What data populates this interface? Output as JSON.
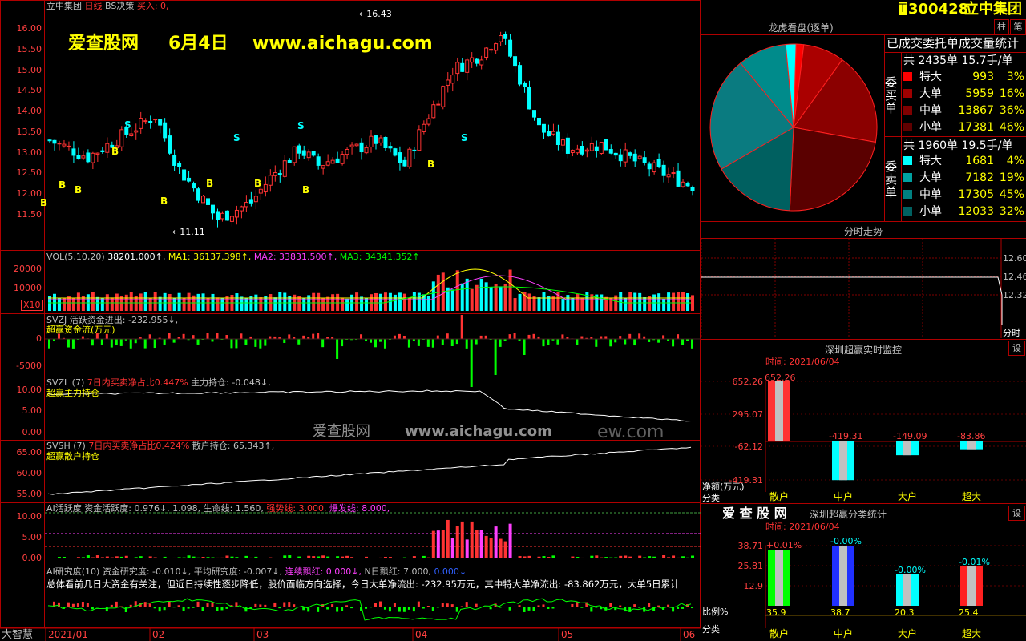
{
  "stock": {
    "code": "300428",
    "name": "立中集团",
    "badge": "T"
  },
  "main_chart": {
    "header": [
      {
        "t": "立中集团",
        "c": "gry"
      },
      {
        "t": "日线",
        "c": "red"
      },
      {
        "t": "BS决策",
        "c": "gry"
      },
      {
        "t": "买入: 0,",
        "c": "red"
      }
    ],
    "watermark": {
      "site": "爱查股网",
      "date": "6月4日",
      "url": "www.aichagu.com"
    },
    "yticks": [
      "16.00",
      "15.50",
      "15.00",
      "14.50",
      "14.00",
      "13.50",
      "13.00",
      "12.50",
      "12.00",
      "11.50"
    ],
    "high_label": "16.43",
    "low_label": "11.11",
    "signals": {
      "b": "B",
      "s": "S"
    }
  },
  "vol": {
    "header": [
      {
        "t": "VOL(5,10,20)",
        "c": "gry"
      },
      {
        "t": "38201.000↑,",
        "c": "wht"
      },
      {
        "t": "MA1: 36137.398↑,",
        "c": "yel"
      },
      {
        "t": "MA2: 33831.500↑,",
        "c": "mag"
      },
      {
        "t": "MA3: 34341.352↑",
        "c": "grn"
      }
    ],
    "yticks": [
      "20000",
      "10000"
    ],
    "unit": "X10"
  },
  "svzj": {
    "header": [
      {
        "t": "SVZJ",
        "c": "gry"
      },
      {
        "t": "活跃资金进出: -232.955↓,",
        "c": "gry"
      }
    ],
    "sub": "超赢资金流(万元)",
    "yticks": [
      "0",
      "-5000"
    ]
  },
  "svzl": {
    "header": [
      {
        "t": "SVZL (7)",
        "c": "gry"
      },
      {
        "t": "7日内买卖净占比0.447%",
        "c": "red"
      },
      {
        "t": "主力持仓: -0.048↓,",
        "c": "gry"
      }
    ],
    "sub": "超赢主力持仓",
    "yticks": [
      "10.00",
      "5.00",
      "0.00"
    ]
  },
  "svsh": {
    "header": [
      {
        "t": "SVSH (7)",
        "c": "gry"
      },
      {
        "t": "7日内买卖净占比0.424%",
        "c": "red"
      },
      {
        "t": "散户持仓: 65.343↑,",
        "c": "gry"
      }
    ],
    "sub": "超赢散户持仓",
    "yticks": [
      "65.00",
      "60.00",
      "55.00"
    ]
  },
  "ai_active": {
    "header": [
      {
        "t": "AI活跃度",
        "c": "gry"
      },
      {
        "t": "资金活跃度: 0.976↓,",
        "c": "gry"
      },
      {
        "t": "1.098,",
        "c": "gry"
      },
      {
        "t": "生命线: 1.560,",
        "c": "gry"
      },
      {
        "t": "强势线: 3.000,",
        "c": "red"
      },
      {
        "t": "爆发线: 8.000,",
        "c": "mag"
      }
    ],
    "yticks": [
      "10.00",
      "5.00",
      "0.00"
    ]
  },
  "ai_research": {
    "header": [
      {
        "t": "AI研究度(10)",
        "c": "gry"
      },
      {
        "t": "资金研究度: -0.010↓,",
        "c": "gry"
      },
      {
        "t": "平均研究度: -0.007↓,",
        "c": "gry"
      },
      {
        "t": "连续飘红: 0.000↓,",
        "c": "mag"
      },
      {
        "t": "N日飘红: 7.000,",
        "c": "gry"
      },
      {
        "t": "0.000↓",
        "c": "blu"
      }
    ],
    "summary": "总体看前几日大资金有关注，但近日持续性逐步降低，股价面临方向选择，今日大单净流出: -232.95万元，其中特大单净流出: -83.862万元，大单5日累计"
  },
  "time_axis": [
    "2021/01",
    "02",
    "03",
    "04",
    "05",
    "06"
  ],
  "logo": "大智慧",
  "watermark2": {
    "cn": "爱查股网",
    "url": "www.aichagu.com",
    "tail": "ew.com"
  },
  "right": {
    "buttons": [
      "柱",
      "笔"
    ],
    "dragon": {
      "title": "龙虎看盘(逐单)",
      "subtitle": "已成交委托单成交量统计",
      "buy": {
        "side_label": "委买单",
        "total": "共 2435单 15.7手/单",
        "rows": [
          {
            "label": "特大",
            "count": "993",
            "pct": "3%",
            "color": "#ff0000"
          },
          {
            "label": "大单",
            "count": "5959",
            "pct": "16%",
            "color": "#a00000"
          },
          {
            "label": "中单",
            "count": "13867",
            "pct": "36%",
            "color": "#800000"
          },
          {
            "label": "小单",
            "count": "17381",
            "pct": "46%",
            "color": "#600000"
          }
        ]
      },
      "sell": {
        "side_label": "委卖单",
        "total": "共 1960单 19.5手/单",
        "rows": [
          {
            "label": "特大",
            "count": "1681",
            "pct": "4%",
            "color": "#00ffff"
          },
          {
            "label": "大单",
            "count": "7182",
            "pct": "19%",
            "color": "#00a0a0"
          },
          {
            "label": "中单",
            "count": "17305",
            "pct": "45%",
            "color": "#008080"
          },
          {
            "label": "小单",
            "count": "12033",
            "pct": "32%",
            "color": "#006060"
          }
        ]
      },
      "pie": [
        {
          "v": 3,
          "color": "#ff0000"
        },
        {
          "v": 16,
          "color": "#aa0000"
        },
        {
          "v": 36,
          "color": "#8b0000"
        },
        {
          "v": 46,
          "color": "#5a0000"
        },
        {
          "v": 32,
          "color": "#006060"
        },
        {
          "v": 45,
          "color": "#0a7b80"
        },
        {
          "v": 19,
          "color": "#008b8b"
        },
        {
          "v": 4,
          "color": "#00ffff"
        }
      ]
    },
    "intraday": {
      "title": "分时走势",
      "yticks": [
        "12.60",
        "12.46",
        "12.32"
      ],
      "corner": "分时"
    },
    "monitor": {
      "title": "深圳超赢实时监控",
      "btn": "设",
      "time": "时间: 2021/06/04",
      "yticks": [
        "652.26",
        "295.07",
        "-62.12",
        "-419.31"
      ],
      "axis_label": "净额(万元)",
      "cat_label": "分类",
      "bars": [
        {
          "cat": "散户",
          "value": 652.26,
          "label": "652.26"
        },
        {
          "cat": "中户",
          "value": -419.31,
          "label": "-419.31"
        },
        {
          "cat": "大户",
          "value": -149.09,
          "label": "-149.09"
        },
        {
          "cat": "超大",
          "value": -83.86,
          "label": "-83.86"
        }
      ]
    },
    "stats": {
      "title": "深圳超赢分类统计",
      "logo": "爱 查 股 网",
      "btn": "设",
      "time": "时间: 2021/06/04",
      "yticks": [
        "38.71",
        "25.81",
        "12.9"
      ],
      "axis_label": "比例%",
      "cat_label": "分类",
      "bars": [
        {
          "cat": "散户",
          "value": 35.9,
          "label": "35.9",
          "top": "+0.01%"
        },
        {
          "cat": "中户",
          "value": 38.7,
          "label": "38.7",
          "top": "-0.00%"
        },
        {
          "cat": "大户",
          "value": 20.3,
          "label": "20.3",
          "top": "-0.00%"
        },
        {
          "cat": "超大",
          "value": 25.4,
          "label": "25.4",
          "top": "-0.01%"
        }
      ]
    }
  }
}
